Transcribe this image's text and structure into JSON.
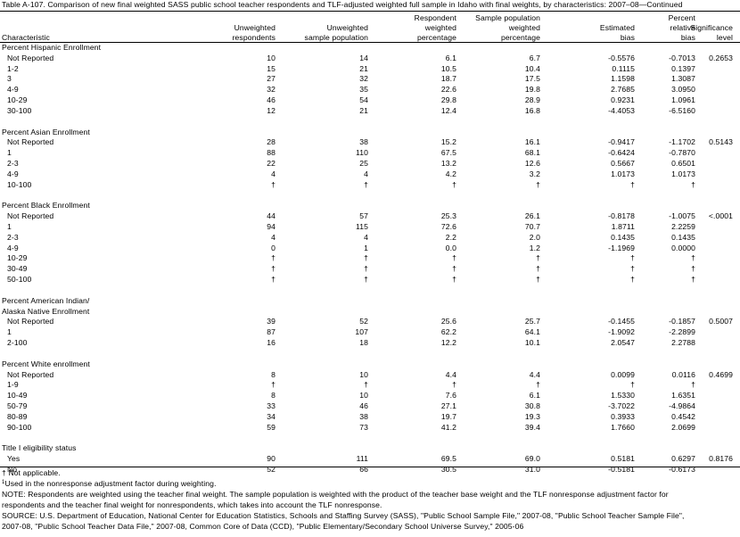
{
  "title": "Table A-107. Comparison of new final weighted SASS public school teacher respondents and TLF-adjusted weighted full sample in Idaho with final weights, by characteristics: 2007–08—Continued",
  "headers": {
    "characteristic": "Characteristic",
    "unweighted_respondents": "Unweighted\nrespondents",
    "unweighted_sample": "Unweighted\nsample population",
    "respondent_weighted": "Respondent\nweighted\npercentage",
    "sample_weighted": "Sample population\nweighted\npercentage",
    "estimated_bias": "Estimated\nbias",
    "relative_bias": "Percent\nrelative\nbias",
    "significance": "Significance\nlevel"
  },
  "sections": [
    {
      "title": [
        "Percent Hispanic Enrollment"
      ],
      "rows": [
        [
          "Not Reported",
          "10",
          "14",
          "6.1",
          "6.7",
          "-0.5576",
          "-0.7013",
          "0.2653"
        ],
        [
          "1-2",
          "15",
          "21",
          "10.5",
          "10.4",
          "0.1115",
          "0.1397",
          ""
        ],
        [
          "3",
          "27",
          "32",
          "18.7",
          "17.5",
          "1.1598",
          "1.3087",
          ""
        ],
        [
          "4-9",
          "32",
          "35",
          "22.6",
          "19.8",
          "2.7685",
          "3.0950",
          ""
        ],
        [
          "10-29",
          "46",
          "54",
          "29.8",
          "28.9",
          "0.9231",
          "1.0961",
          ""
        ],
        [
          "30-100",
          "12",
          "21",
          "12.4",
          "16.8",
          "-4.4053",
          "-6.5160",
          ""
        ]
      ]
    },
    {
      "title": [
        "Percent Asian Enrollment"
      ],
      "rows": [
        [
          "Not Reported",
          "28",
          "38",
          "15.2",
          "16.1",
          "-0.9417",
          "-1.1702",
          "0.5143"
        ],
        [
          "1",
          "88",
          "110",
          "67.5",
          "68.1",
          "-0.6424",
          "-0.7870",
          ""
        ],
        [
          "2-3",
          "22",
          "25",
          "13.2",
          "12.6",
          "0.5667",
          "0.6501",
          ""
        ],
        [
          "4-9",
          "4",
          "4",
          "4.2",
          "3.2",
          "1.0173",
          "1.0173",
          ""
        ],
        [
          "10-100",
          "†",
          "†",
          "†",
          "†",
          "†",
          "†",
          ""
        ]
      ]
    },
    {
      "title": [
        "Percent Black Enrollment"
      ],
      "rows": [
        [
          "Not Reported",
          "44",
          "57",
          "25.3",
          "26.1",
          "-0.8178",
          "-1.0075",
          "<.0001"
        ],
        [
          "1",
          "94",
          "115",
          "72.6",
          "70.7",
          "1.8711",
          "2.2259",
          ""
        ],
        [
          "2-3",
          "4",
          "4",
          "2.2",
          "2.0",
          "0.1435",
          "0.1435",
          ""
        ],
        [
          "4-9",
          "0",
          "1",
          "0.0",
          "1.2",
          "-1.1969",
          "0.0000",
          ""
        ],
        [
          "10-29",
          "†",
          "†",
          "†",
          "†",
          "†",
          "†",
          ""
        ],
        [
          "30-49",
          "†",
          "†",
          "†",
          "†",
          "†",
          "†",
          ""
        ],
        [
          "50-100",
          "†",
          "†",
          "†",
          "†",
          "†",
          "†",
          ""
        ]
      ]
    },
    {
      "title": [
        "Percent American Indian/",
        "Alaska Native Enrollment"
      ],
      "rows": [
        [
          "Not Reported",
          "39",
          "52",
          "25.6",
          "25.7",
          "-0.1455",
          "-0.1857",
          "0.5007"
        ],
        [
          "1",
          "87",
          "107",
          "62.2",
          "64.1",
          "-1.9092",
          "-2.2899",
          ""
        ],
        [
          "2-100",
          "16",
          "18",
          "12.2",
          "10.1",
          "2.0547",
          "2.2788",
          ""
        ]
      ]
    },
    {
      "title": [
        "Percent White enrollment"
      ],
      "rows": [
        [
          "Not Reported",
          "8",
          "10",
          "4.4",
          "4.4",
          "0.0099",
          "0.0116",
          "0.4699"
        ],
        [
          "1-9",
          "†",
          "†",
          "†",
          "†",
          "†",
          "†",
          ""
        ],
        [
          "10-49",
          "8",
          "10",
          "7.6",
          "6.1",
          "1.5330",
          "1.6351",
          ""
        ],
        [
          "50-79",
          "33",
          "46",
          "27.1",
          "30.8",
          "-3.7022",
          "-4.9864",
          ""
        ],
        [
          "80-89",
          "34",
          "38",
          "19.7",
          "19.3",
          "0.3933",
          "0.4542",
          ""
        ],
        [
          "90-100",
          "59",
          "73",
          "41.2",
          "39.4",
          "1.7660",
          "2.0699",
          ""
        ]
      ]
    },
    {
      "title": [
        "Title I eligibility status"
      ],
      "rows": [
        [
          "Yes",
          "90",
          "111",
          "69.5",
          "69.0",
          "0.5181",
          "0.6297",
          "0.8176"
        ],
        [
          "No",
          "52",
          "66",
          "30.5",
          "31.0",
          "-0.5181",
          "-0.6173",
          ""
        ]
      ]
    }
  ],
  "footnotes": {
    "dagger": "† Not applicable.",
    "note1_mark": "1",
    "note1": "Used in the nonresponse adjustment factor during weighting.",
    "note": "NOTE: Respondents are weighted using the teacher final weight. The sample population is weighted with the product of the teacher base weight and the TLF nonresponse adjustment factor for",
    "note_cont": "respondents and the teacher final weight for nonrespondents, which takes into account the TLF nonresponse.",
    "source": "SOURCE: U.S. Department of Education, National Center for Education Statistics, Schools and Staffing Survey (SASS), \"Public School Sample File,\" 2007-08, \"Public School Teacher Sample File\",",
    "source_cont": "2007-08, \"Public School Teacher Data File,\" 2007-08, Common Core of Data (CCD), \"Public Elementary/Secondary School Universe Survey,\" 2005-06"
  }
}
